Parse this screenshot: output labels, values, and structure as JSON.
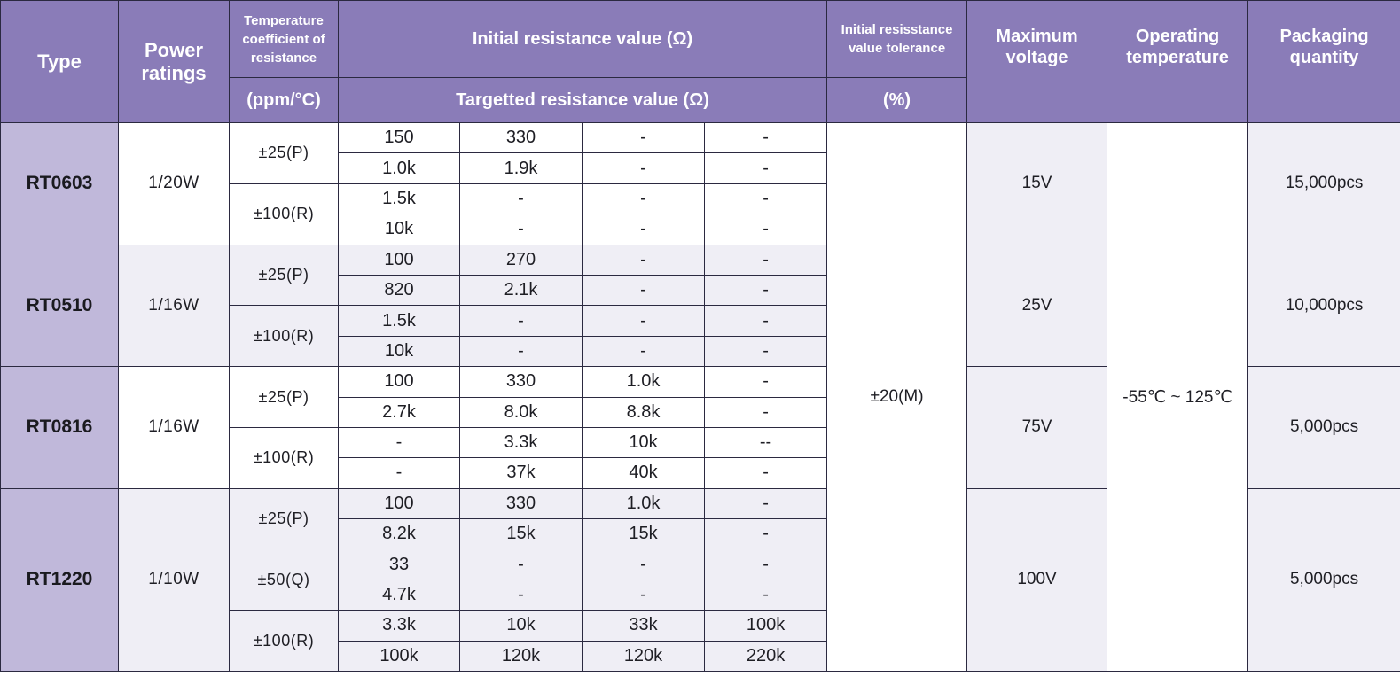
{
  "headers": {
    "type": "Type",
    "power": "Power ratings",
    "tcr_top": "Temperature coefficient of resistance",
    "tcr_unit": "(ppm/°C)",
    "initial_resistance": "Initial resistance value (Ω)",
    "targetted_resistance": "Targetted resistance value (Ω)",
    "tolerance_top": "Initial resisstance value tolerance",
    "tolerance_unit": "(%)",
    "max_voltage": "Maximum voltage",
    "operating_temp": "Operating temperature",
    "packaging": "Packaging quantity"
  },
  "shared": {
    "tolerance": "±20(M)",
    "operating_temp": "-55℃ ~ 125℃"
  },
  "colors": {
    "header_bg": "#8a7cb8",
    "type_bg": "#c0b8da",
    "alt_row_bg": "#efeef5",
    "border": "#2b2940"
  },
  "groups": [
    {
      "type": "RT0603",
      "power": "1/20W",
      "max_voltage": "15V",
      "packaging": "15,000pcs",
      "tcr": [
        {
          "label": "±25(P)",
          "rows": [
            [
              "150",
              "330",
              "-",
              "-"
            ],
            [
              "1.0k",
              "1.9k",
              "-",
              "-"
            ]
          ]
        },
        {
          "label": "±100(R)",
          "rows": [
            [
              "1.5k",
              "-",
              "-",
              "-"
            ],
            [
              "10k",
              "-",
              "-",
              "-"
            ]
          ]
        }
      ]
    },
    {
      "type": "RT0510",
      "power": "1/16W",
      "max_voltage": "25V",
      "packaging": "10,000pcs",
      "tcr": [
        {
          "label": "±25(P)",
          "rows": [
            [
              "100",
              "270",
              "-",
              "-"
            ],
            [
              "820",
              "2.1k",
              "-",
              "-"
            ]
          ]
        },
        {
          "label": "±100(R)",
          "rows": [
            [
              "1.5k",
              "-",
              "-",
              "-"
            ],
            [
              "10k",
              "-",
              "-",
              "-"
            ]
          ]
        }
      ]
    },
    {
      "type": "RT0816",
      "power": "1/16W",
      "max_voltage": "75V",
      "packaging": "5,000pcs",
      "tcr": [
        {
          "label": "±25(P)",
          "rows": [
            [
              "100",
              "330",
              "1.0k",
              "-"
            ],
            [
              "2.7k",
              "8.0k",
              "8.8k",
              "-"
            ]
          ]
        },
        {
          "label": "±100(R)",
          "rows": [
            [
              "-",
              "3.3k",
              "10k",
              "--"
            ],
            [
              "-",
              "37k",
              "40k",
              "-"
            ]
          ]
        }
      ]
    },
    {
      "type": "RT1220",
      "power": "1/10W",
      "max_voltage": "100V",
      "packaging": "5,000pcs",
      "tcr": [
        {
          "label": "±25(P)",
          "rows": [
            [
              "100",
              "330",
              "1.0k",
              "-"
            ],
            [
              "8.2k",
              "15k",
              "15k",
              "-"
            ]
          ]
        },
        {
          "label": "±50(Q)",
          "rows": [
            [
              "33",
              "-",
              "-",
              "-"
            ],
            [
              "4.7k",
              "-",
              "-",
              "-"
            ]
          ]
        },
        {
          "label": "±100(R)",
          "rows": [
            [
              "3.3k",
              "10k",
              "33k",
              "100k"
            ],
            [
              "100k",
              "120k",
              "120k",
              "220k"
            ]
          ]
        }
      ]
    }
  ]
}
